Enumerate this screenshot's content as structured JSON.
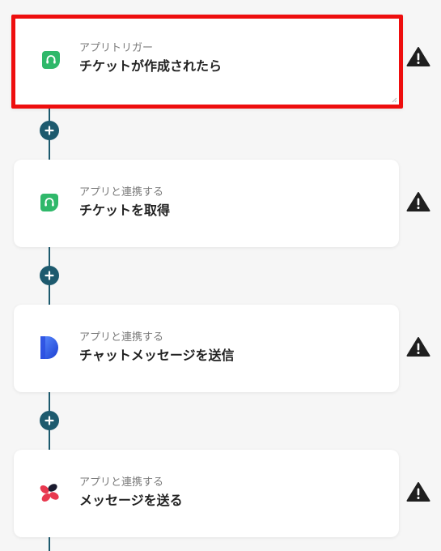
{
  "flow": {
    "steps": [
      {
        "label": "アプリトリガー",
        "title": "チケットが作成されたら",
        "app_icon": "headset-chat-icon",
        "selected": true
      },
      {
        "label": "アプリと連携する",
        "title": "チケットを取得",
        "app_icon": "headset-chat-icon",
        "selected": false
      },
      {
        "label": "アプリと連携する",
        "title": "チャットメッセージを送信",
        "app_icon": "letter-d-logo-icon",
        "selected": false
      },
      {
        "label": "アプリと連携する",
        "title": "メッセージを送る",
        "app_icon": "pinwheel-logo-icon",
        "selected": false
      }
    ],
    "add_step_icon": "plus-icon",
    "warning_icon": "warning-triangle-icon"
  },
  "colors": {
    "selected_border": "#ee0e0e",
    "connector": "#1d5a6e",
    "headset_green": "#2fb86a",
    "warning": "#1f1f1f"
  }
}
